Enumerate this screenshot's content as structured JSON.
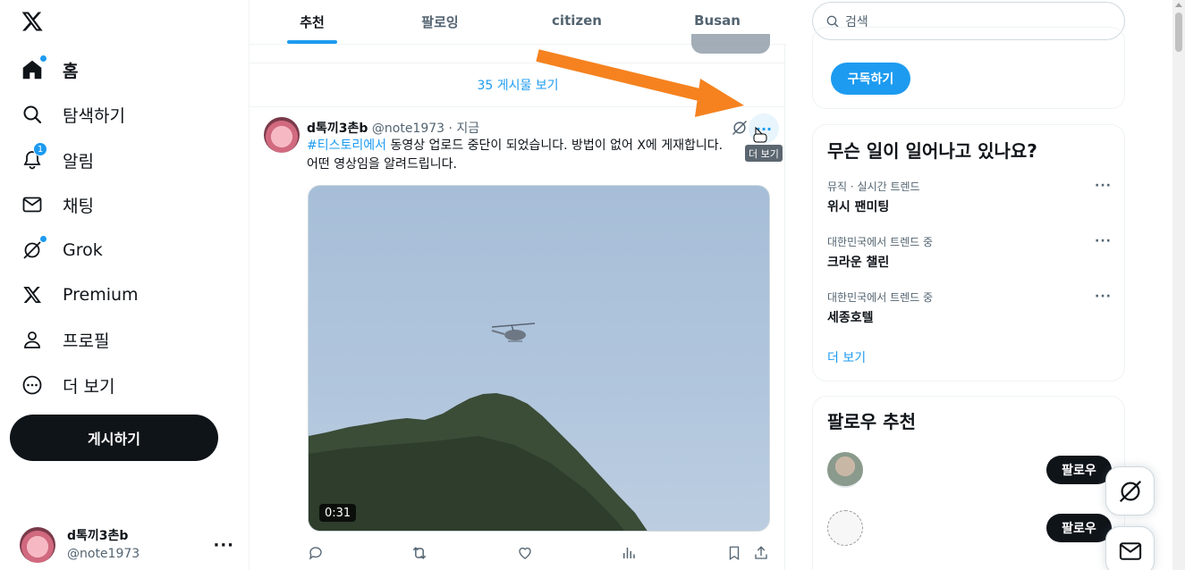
{
  "nav": {
    "items": [
      {
        "label": "홈",
        "icon": "home-icon"
      },
      {
        "label": "탐색하기",
        "icon": "search-icon"
      },
      {
        "label": "알림",
        "icon": "bell-icon",
        "badge": "1"
      },
      {
        "label": "채팅",
        "icon": "mail-icon"
      },
      {
        "label": "Grok",
        "icon": "grok-icon"
      },
      {
        "label": "Premium",
        "icon": "x-logo-icon"
      },
      {
        "label": "프로필",
        "icon": "person-icon"
      },
      {
        "label": "더 보기",
        "icon": "more-circle-icon"
      }
    ],
    "post_button": "게시하기"
  },
  "account": {
    "name": "d톡끼3촌b",
    "handle": "@note1973",
    "more": "···"
  },
  "tabs": [
    "추천",
    "팔로잉",
    "citizen",
    "Busan"
  ],
  "feed": {
    "show_posts": "35 게시물 보기",
    "tweet": {
      "name": "d톡끼3촌b",
      "handle": "@note1973",
      "time": "· 지금",
      "hashtag": "#티스토리에서",
      "text": " 동영상 업로드 중단이 되었습니다. 방법이 없어 X에 게재합니다. 어떤 영상임을 알려드립니다.",
      "tooltip": "더 보기",
      "more": "···",
      "video_duration": "0:31"
    }
  },
  "right": {
    "search_placeholder": "검색",
    "subscribe_button": "구독하기",
    "trends_title": "무슨 일이 일어나고 있나요?",
    "trends": [
      {
        "meta": "뮤직 · 실시간 트렌드",
        "name": "위시 팬미팅"
      },
      {
        "meta": "대한민국에서 트렌드 중",
        "name": "크라운 챌린"
      },
      {
        "meta": "대한민국에서 트렌드 중",
        "name": "세종호텔"
      }
    ],
    "trend_more": "···",
    "show_more": "더 보기",
    "follow_title": "팔로우 추천",
    "follow_button": "팔로우"
  },
  "colors": {
    "accent": "#1d9bf0",
    "arrow": "#f5821f",
    "text": "#0f1419",
    "muted": "#536471"
  }
}
